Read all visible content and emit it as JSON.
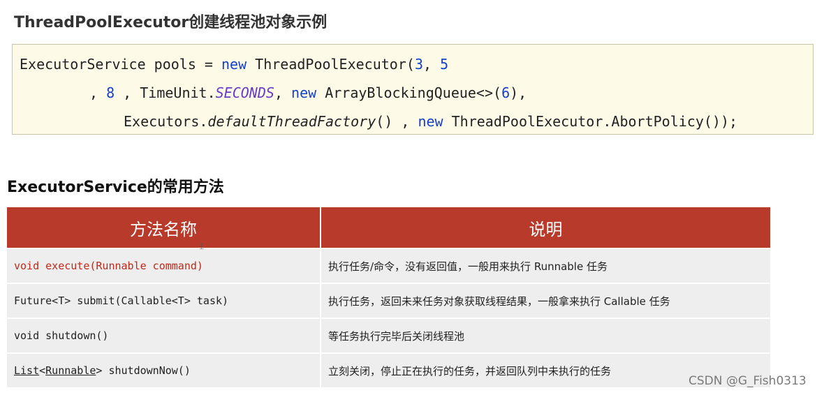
{
  "section1": {
    "title": "ThreadPoolExecutor创建线程池对象示例",
    "code": {
      "l1_a": "ExecutorService pools = ",
      "l1_new": "new",
      "l1_b": " ThreadPoolExecutor(",
      "l1_n3": "3",
      "l1_comma": ", ",
      "l1_n5": "5",
      "l2_a": ", ",
      "l2_n8": "8",
      "l2_b": " , TimeUnit.",
      "l2_seconds": "SECONDS",
      "l2_c": ", ",
      "l2_new": "new",
      "l2_d": " ArrayBlockingQueue<>(",
      "l2_n6": "6",
      "l2_e": "),",
      "l3_a": "Executors.",
      "l3_fn": "defaultThreadFactory",
      "l3_b": "() , ",
      "l3_new": "new",
      "l3_c": " ThreadPoolExecutor.AbortPolicy());"
    }
  },
  "section2": {
    "title": "ExecutorService的常用方法",
    "headers": [
      "方法名称",
      "说明"
    ],
    "rows": [
      {
        "method": "void execute(Runnable command)",
        "desc": "执行任务/命令，没有返回值，一般用来执行 Runnable 任务"
      },
      {
        "method": "Future<T> submit(Callable<T> task)",
        "desc": "执行任务，返回未来任务对象获取线程结果，一般拿来执行 Callable 任务"
      },
      {
        "method": "void shutdown()",
        "desc": "等任务执行完毕后关闭线程池"
      },
      {
        "method_a": "List",
        "method_b": "<",
        "method_c": "Runnable",
        "method_d": "> shutdownNow()",
        "desc": "立刻关闭，停止正在执行的任务，并返回队列中未执行的任务"
      }
    ]
  },
  "watermark": "CSDN @G_Fish0313",
  "colors": {
    "header_bg": "#b73a2a",
    "row_bg": "#eeeeee",
    "code_bg": "#fdfbe8",
    "keyword": "#1740c8",
    "highlight_red": "#c0291a"
  }
}
